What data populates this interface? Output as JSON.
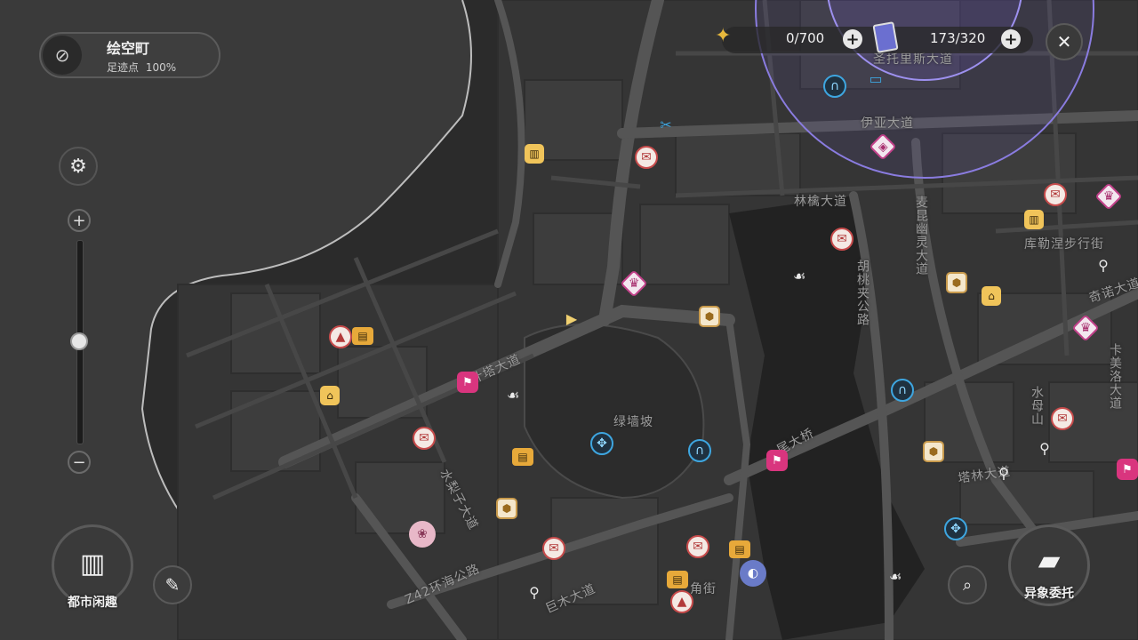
{
  "location": {
    "name": "绘空町",
    "footprint_label": "足迹点",
    "footprint_value": "100%"
  },
  "resources": {
    "first": "0/700",
    "second": "173/320"
  },
  "buttons": {
    "city_fun": "都市闲趣",
    "anomaly_commission": "异象委托"
  },
  "zoom": {
    "level": 0.5
  },
  "map_labels": {
    "saint_tolis": "圣托里斯大道",
    "yiya": "伊亚大道",
    "linqin": "林檎大道",
    "maikun": "麦昆幽灵大道",
    "hutao": "胡桃夹公路",
    "kulenie": "库勒涅步行街",
    "qinuo": "奇诺大道",
    "kamei": "卡美洛大道",
    "shuimu": "水母山",
    "tadon": "塔林大道",
    "lvqiang": "绿墙坡",
    "ye_ta": "常叶塔大道",
    "shuili": "水梨子大道",
    "z42": "Z42环海公路",
    "ju_mu": "巨木大道",
    "jiao_jie": "角街",
    "wei_bridge": "尾大桥"
  }
}
